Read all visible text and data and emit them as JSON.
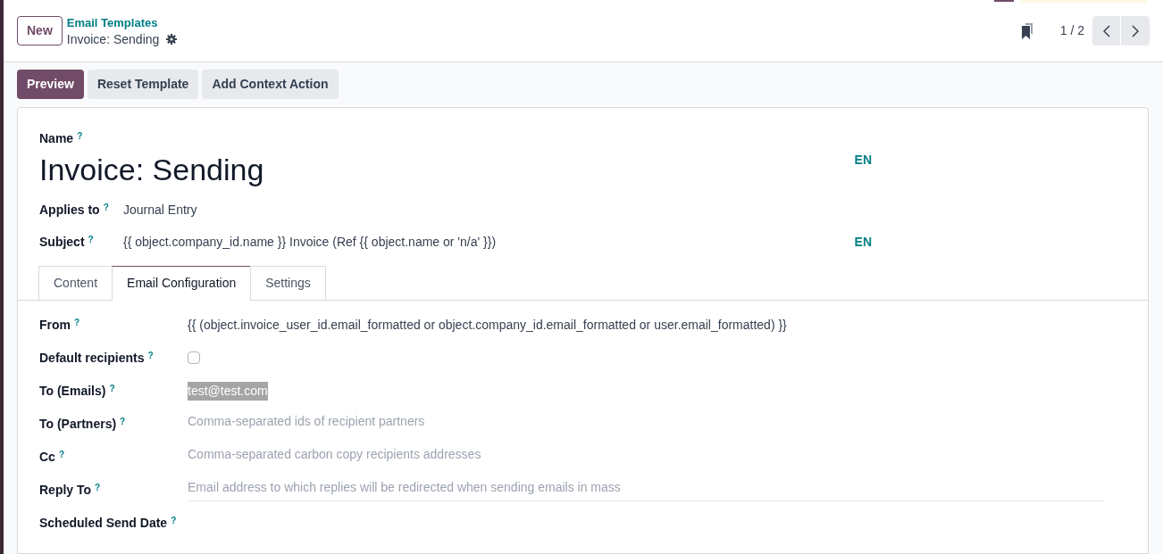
{
  "control_panel": {
    "new_button": "New",
    "breadcrumb": "Email Templates",
    "record_title": "Invoice: Sending",
    "pager": "1 / 2"
  },
  "action_buttons": [
    {
      "label": "Preview",
      "primary": true
    },
    {
      "label": "Reset Template",
      "primary": false
    },
    {
      "label": "Add Context Action",
      "primary": false
    }
  ],
  "form": {
    "name": {
      "label": "Name",
      "help": "?",
      "value": "Invoice: Sending",
      "lang": "EN"
    },
    "applies_to": {
      "label": "Applies to",
      "help": "?",
      "value": "Journal Entry"
    },
    "subject": {
      "label": "Subject",
      "help": "?",
      "value": "{{ object.company_id.name }} Invoice (Ref {{ object.name or 'n/a' }})",
      "lang": "EN"
    }
  },
  "tabs": [
    {
      "label": "Content",
      "selected": false
    },
    {
      "label": "Email Configuration",
      "selected": true
    },
    {
      "label": "Settings",
      "selected": false
    }
  ],
  "fields": [
    {
      "label": "From",
      "help": "?",
      "kind": "text",
      "value": "{{ (object.invoice_user_id.email_formatted or object.company_id.email_formatted or user.email_formatted) }}"
    },
    {
      "label": "Default recipients",
      "help": "?",
      "kind": "checkbox",
      "checked": false
    },
    {
      "label": "To (Emails)",
      "help": "?",
      "kind": "selected_text",
      "value": "test@test.com"
    },
    {
      "label": "To (Partners)",
      "help": "?",
      "kind": "input",
      "placeholder": "Comma-separated ids of recipient partners",
      "focused": false
    },
    {
      "label": "Cc",
      "help": "?",
      "kind": "input",
      "placeholder": "Comma-separated carbon copy recipients addresses",
      "focused": false
    },
    {
      "label": "Reply To",
      "help": "?",
      "kind": "input",
      "placeholder": "Email address to which replies will be redirected when sending emails in mass",
      "focused": true
    },
    {
      "label": "Scheduled Send Date",
      "help": "?",
      "kind": "empty"
    }
  ]
}
